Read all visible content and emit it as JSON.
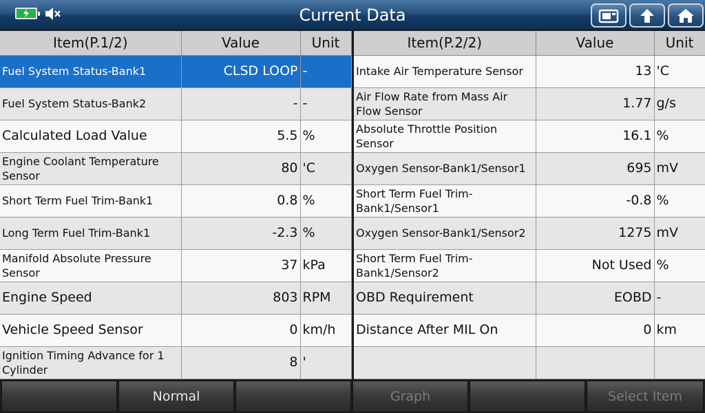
{
  "header": {
    "title": "Current Data"
  },
  "icons": [
    "battery-icon",
    "speaker-muted-icon",
    "capture-icon",
    "up-arrow-icon",
    "home-icon"
  ],
  "colors": {
    "selected_row": "#1a6fc8",
    "titlebar": "#27517d"
  },
  "left_table": {
    "headers": {
      "item": "Item(P.1/2)",
      "value": "Value",
      "unit": "Unit"
    },
    "rows": [
      {
        "item": "Fuel System Status-Bank1",
        "value": "CLSD LOOP",
        "unit": "-"
      },
      {
        "item": "Fuel System Status-Bank2",
        "value": "-",
        "unit": "-"
      },
      {
        "item": "Calculated Load Value",
        "value": "5.5",
        "unit": "%"
      },
      {
        "item": "Engine Coolant Temperature Sensor",
        "value": "80",
        "unit": "'C"
      },
      {
        "item": "Short Term Fuel Trim-Bank1",
        "value": "0.8",
        "unit": "%"
      },
      {
        "item": "Long Term Fuel Trim-Bank1",
        "value": "-2.3",
        "unit": "%"
      },
      {
        "item": "Manifold Absolute Pressure Sensor",
        "value": "37",
        "unit": "kPa"
      },
      {
        "item": "Engine Speed",
        "value": "803",
        "unit": "RPM"
      },
      {
        "item": "Vehicle Speed Sensor",
        "value": "0",
        "unit": "km/h"
      },
      {
        "item": "Ignition Timing Advance for 1 Cylinder",
        "value": "8",
        "unit": "'"
      }
    ]
  },
  "right_table": {
    "headers": {
      "item": "Item(P.2/2)",
      "value": "Value",
      "unit": "Unit"
    },
    "rows": [
      {
        "item": "Intake Air Temperature Sensor",
        "value": "13",
        "unit": "'C"
      },
      {
        "item": "Air Flow Rate from Mass Air Flow Sensor",
        "value": "1.77",
        "unit": "g/s"
      },
      {
        "item": "Absolute Throttle Position Sensor",
        "value": "16.1",
        "unit": "%"
      },
      {
        "item": "Oxygen Sensor-Bank1/Sensor1",
        "value": "695",
        "unit": "mV"
      },
      {
        "item": "Short Term Fuel Trim-Bank1/Sensor1",
        "value": "-0.8",
        "unit": "%"
      },
      {
        "item": "Oxygen Sensor-Bank1/Sensor2",
        "value": "1275",
        "unit": "mV"
      },
      {
        "item": "Short Term Fuel Trim-Bank1/Sensor2",
        "value": "Not Used",
        "unit": "%"
      },
      {
        "item": "OBD Requirement",
        "value": "EOBD",
        "unit": "-"
      },
      {
        "item": "Distance After MIL On",
        "value": "0",
        "unit": "km"
      },
      {
        "item": "",
        "value": "",
        "unit": ""
      }
    ]
  },
  "footer": {
    "buttons": [
      {
        "label": "",
        "enabled": true
      },
      {
        "label": "Normal",
        "enabled": true
      },
      {
        "label": "",
        "enabled": true
      },
      {
        "label": "Graph",
        "enabled": false
      },
      {
        "label": "",
        "enabled": true
      },
      {
        "label": "Select Item",
        "enabled": false
      }
    ]
  }
}
